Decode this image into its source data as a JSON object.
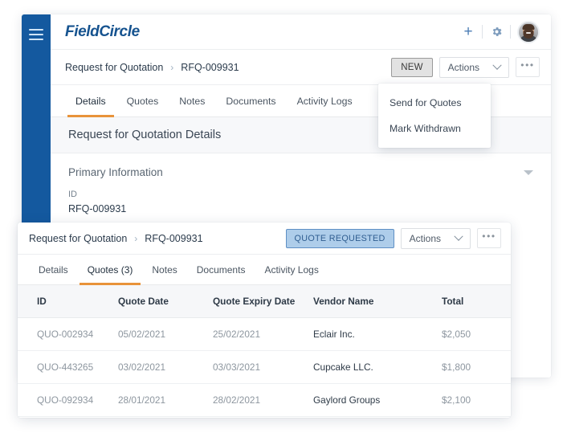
{
  "card1": {
    "sidebar": {
      "menu_icon": "hamburger-menu-icon"
    },
    "topbar": {
      "logo": "FieldCircle",
      "add_icon": "plus-icon",
      "settings_icon": "gear-icon",
      "avatar": "user-avatar"
    },
    "breadcrumb": {
      "parent": "Request for Quotation",
      "separator": "›",
      "current": "RFQ-009931"
    },
    "actions": {
      "new_label": "NEW",
      "actions_label": "Actions",
      "more_label": "•••"
    },
    "tabs": [
      {
        "label": "Details",
        "active": true
      },
      {
        "label": "Quotes",
        "active": false
      },
      {
        "label": "Notes",
        "active": false
      },
      {
        "label": "Documents",
        "active": false
      },
      {
        "label": "Activity Logs",
        "active": false
      }
    ],
    "section_title": "Request for Quotation Details",
    "panel": {
      "title": "Primary Information",
      "collapse_icon": "caret-down-icon",
      "fields": [
        {
          "label": "ID",
          "value": "RFQ-009931"
        }
      ]
    },
    "dropdown": {
      "items": [
        {
          "label": "Send for Quotes"
        },
        {
          "label": "Mark Withdrawn"
        }
      ]
    }
  },
  "card2": {
    "breadcrumb": {
      "parent": "Request for Quotation",
      "separator": "›",
      "current": "RFQ-009931"
    },
    "status_badge": "QUOTE REQUESTED",
    "actions": {
      "actions_label": "Actions",
      "more_label": "•••"
    },
    "tabs": [
      {
        "label": "Details",
        "active": false
      },
      {
        "label": "Quotes (3)",
        "active": true
      },
      {
        "label": "Notes",
        "active": false
      },
      {
        "label": "Documents",
        "active": false
      },
      {
        "label": "Activity Logs",
        "active": false
      }
    ],
    "table": {
      "columns": [
        "ID",
        "Quote Date",
        "Quote Expiry Date",
        "Vendor Name",
        "Total"
      ],
      "rows": [
        {
          "id": "QUO-002934",
          "quote_date": "05/02/2021",
          "expiry_date": "25/02/2021",
          "vendor": "Eclair Inc.",
          "total": "$2,050"
        },
        {
          "id": "QUO-443265",
          "quote_date": "03/02/2021",
          "expiry_date": "03/03/2021",
          "vendor": "Cupcake LLC.",
          "total": "$1,800"
        },
        {
          "id": "QUO-092934",
          "quote_date": "28/01/2021",
          "expiry_date": "28/02/2021",
          "vendor": "Gaylord Groups",
          "total": "$2,100"
        }
      ]
    }
  },
  "colors": {
    "sidebar_blue": "#14599f",
    "logo_blue": "#16538f",
    "tab_accent_orange": "#e8933a",
    "badge_bg": "#aecdea",
    "badge_border": "#5e8fc4",
    "badge_text": "#2f5d90"
  }
}
